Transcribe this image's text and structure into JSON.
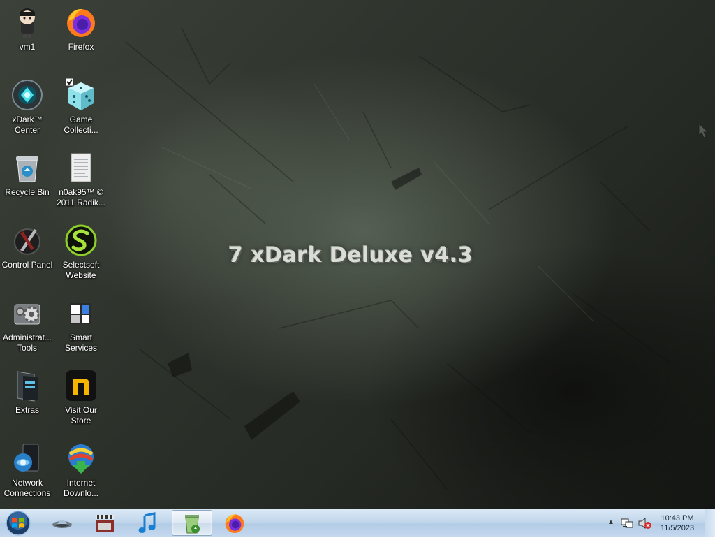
{
  "wallpaper": {
    "title": "7 xDark Deluxe v4.3"
  },
  "desktop_icons": [
    {
      "name": "vm1",
      "icon": "user-avatar-icon"
    },
    {
      "name": "Firefox",
      "icon": "firefox-icon"
    },
    {
      "name": "xDark™\nCenter",
      "icon": "xdark-center-icon"
    },
    {
      "name": "Game\nCollecti...",
      "icon": "dice-icon"
    },
    {
      "name": "Recycle Bin",
      "icon": "recycle-bin-icon"
    },
    {
      "name": "n0ak95™ ©\n2011 Radik...",
      "icon": "document-icon"
    },
    {
      "name": "Control Panel",
      "icon": "control-panel-icon"
    },
    {
      "name": "Selectsoft\nWebsite",
      "icon": "selectsoft-icon"
    },
    {
      "name": "Administrat...\nTools",
      "icon": "admin-tools-icon"
    },
    {
      "name": "Smart\nServices",
      "icon": "smart-services-icon"
    },
    {
      "name": "Extras",
      "icon": "extras-folder-icon"
    },
    {
      "name": "Visit Our\nStore",
      "icon": "store-icon"
    },
    {
      "name": "Network\nConnections",
      "icon": "network-icon"
    },
    {
      "name": "Internet\nDownlo...",
      "icon": "internet-download-manager-icon"
    }
  ],
  "taskbar": {
    "start_icon": "windows-orb-icon",
    "pinned": [
      {
        "icon": "ufo-icon"
      },
      {
        "icon": "film-clapper-icon"
      },
      {
        "icon": "music-note-icon"
      },
      {
        "icon": "recycle-bin-green-icon",
        "active": true
      },
      {
        "icon": "firefox-icon"
      }
    ],
    "tray": {
      "icons": [
        "show-hidden-icons-chevron",
        "network-tray-icon",
        "volume-muted-icon"
      ],
      "time": "10:43 PM",
      "date": "11/5/2023"
    }
  },
  "colors": {
    "taskbar_top": "#dbe9f6",
    "taskbar_bottom": "#b3cce6",
    "desktop_light": "#6f7a6b",
    "desktop_dark": "#141613"
  }
}
